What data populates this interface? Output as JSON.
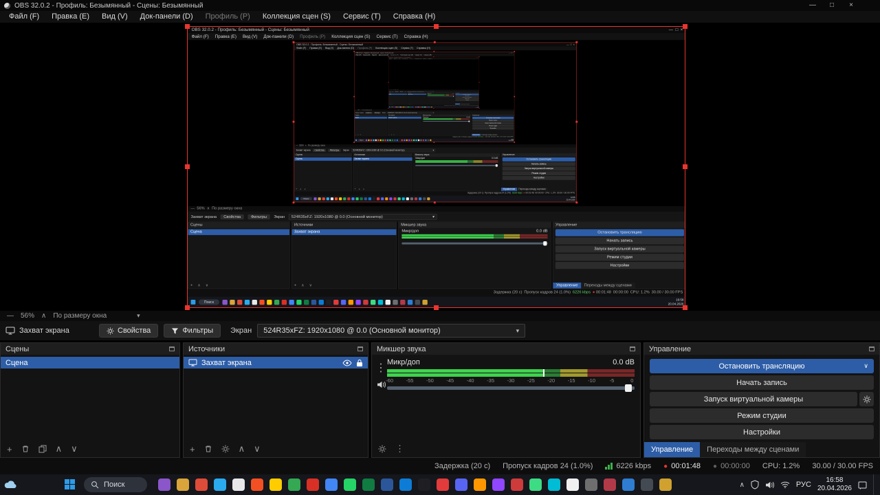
{
  "window": {
    "title": "OBS 32.0.2 - Профиль: Безымянный - Сцены: Безымянный",
    "controls": {
      "minimize": "—",
      "maximize": "□",
      "close": "×"
    }
  },
  "menu": {
    "items": [
      "Файл (F)",
      "Правка (E)",
      "Вид (V)",
      "Док-панели (D)",
      "Профиль (P)",
      "Коллекция сцен (S)",
      "Сервис (T)",
      "Справка (H)"
    ]
  },
  "preview": {
    "zoom": "56%",
    "fit": "По размеру окна"
  },
  "icons": {
    "dash": "—",
    "chevron_up": "∧",
    "chevron_down": "∨",
    "dropdown": "▾",
    "plus": "+",
    "dots": "⋮",
    "dot": "●"
  },
  "source_toolbar": {
    "source": "Захват экрана",
    "properties": "Свойства",
    "filters": "Фильтры",
    "screen": "Экран",
    "monitor": "524R35xFZ: 1920x1080 @ 0.0 (Основной монитор)"
  },
  "scenes": {
    "title": "Сцены",
    "items": [
      "Сцена"
    ]
  },
  "sources": {
    "title": "Источники",
    "items": [
      "Захват экрана"
    ]
  },
  "mixer": {
    "title": "Микшер звука",
    "channel": "Микр/доп",
    "level_db": "0.0 dB",
    "ticks": [
      "-60",
      "-55",
      "-50",
      "-45",
      "-40",
      "-35",
      "-30",
      "-25",
      "-20",
      "-15",
      "-10",
      "-5",
      "0"
    ]
  },
  "controls": {
    "title": "Управление",
    "stop_stream": "Остановить трансляцию",
    "start_record": "Начать запись",
    "virtual_camera": "Запуск виртуальной камеры",
    "studio_mode": "Режим студии",
    "settings": "Настройки",
    "tab_controls": "Управление",
    "tab_transitions": "Переходы между сценами"
  },
  "status_bar": {
    "delay": "Задержка (20 с)",
    "dropped_frames": "Пропуск кадров 24 (1.0%)",
    "bitrate": "6226 kbps",
    "stream_time": "00:01:48",
    "record_time": "00:00:00",
    "cpu": "CPU: 1.2%",
    "fps": "30.00 / 30.00 FPS"
  },
  "taskbar": {
    "search_placeholder": "Поиск",
    "language": "РУС",
    "time": "16:58",
    "date": "20.04.2026",
    "app_colors": [
      "#8a56c9",
      "#d9a43a",
      "#dd4b39",
      "#2aabee",
      "#e8e8e8",
      "#f25022",
      "#ffcc00",
      "#34a853",
      "#d93025",
      "#4285f4",
      "#25d366",
      "#107c41",
      "#2b579a",
      "#0d7cd6",
      "#1f1f23",
      "#e23b3b",
      "#5865f2",
      "#ff9800",
      "#9146ff",
      "#ce3b3b",
      "#3ddc84",
      "#00bcd4",
      "#f0f0f0",
      "#6e6e6e",
      "#b23a48",
      "#2e7dd1",
      "#444a52",
      "#d0a12e"
    ]
  },
  "colors": {
    "accent_blue": "#2d5da7",
    "capture_red": "#e8352f",
    "meter_green": "#3fd24f",
    "meter_yellow": "#a19a2e",
    "meter_red": "#772727"
  }
}
